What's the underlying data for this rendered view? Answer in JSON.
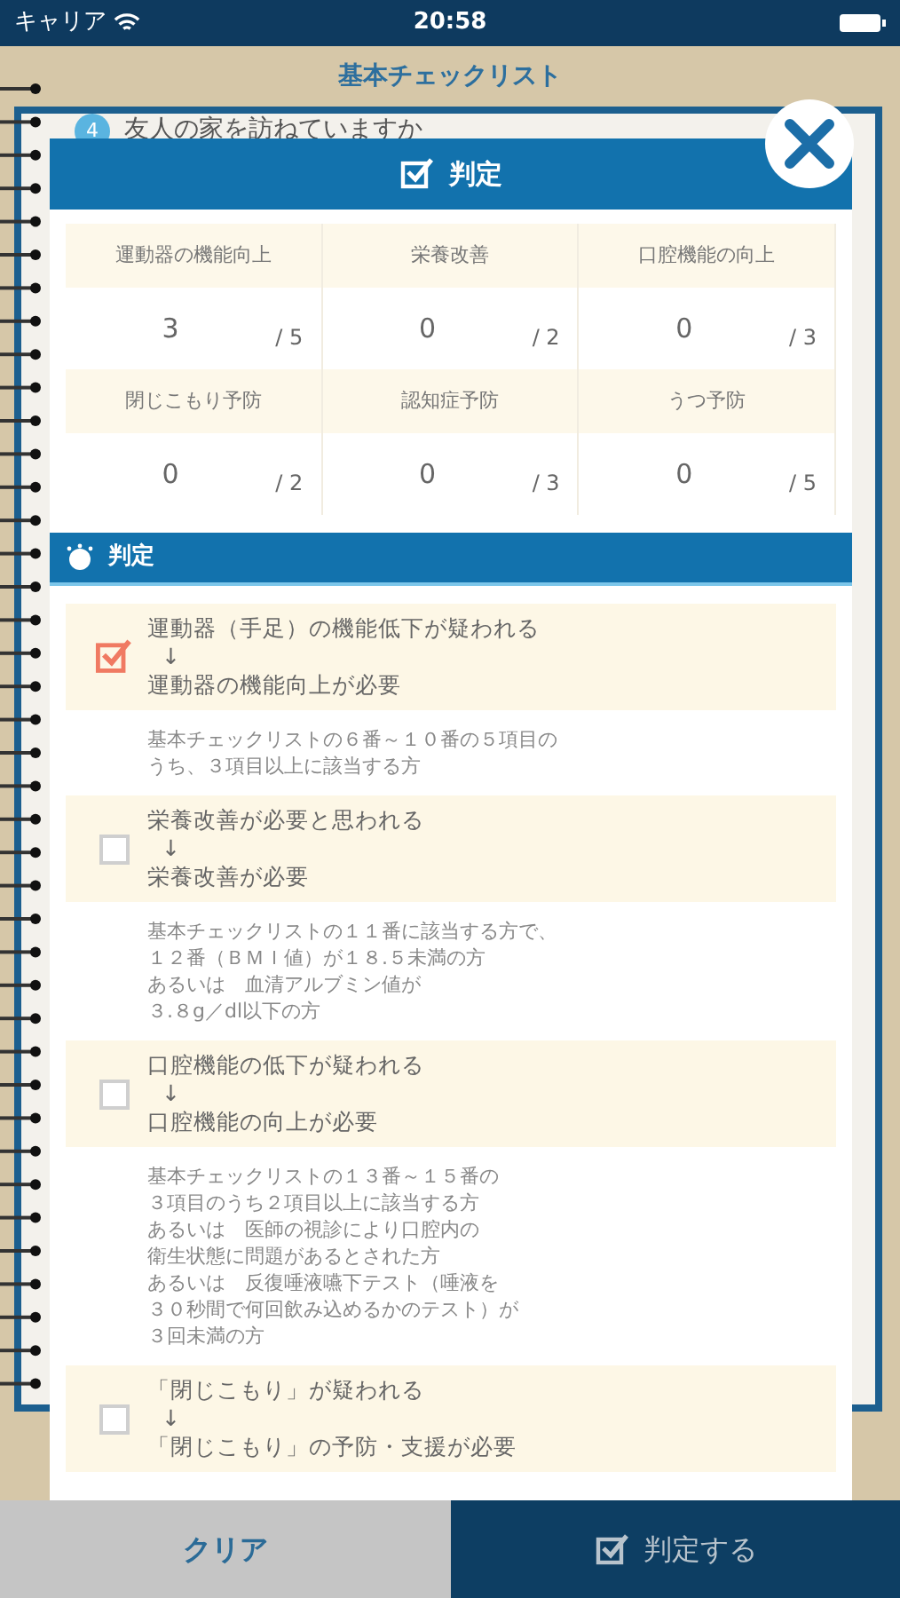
{
  "status_bar": {
    "carrier": "キャリア",
    "time": "20:58"
  },
  "title": "基本チェックリスト",
  "background_question": {
    "number": "4",
    "text": "友人の家を訪ねていますか"
  },
  "dialog": {
    "title": "判定",
    "scores": [
      {
        "label": "運動器の機能向上",
        "value": "3",
        "max": "/ 5"
      },
      {
        "label": "栄養改善",
        "value": "0",
        "max": "/ 2"
      },
      {
        "label": "口腔機能の向上",
        "value": "0",
        "max": "/ 3"
      },
      {
        "label": "閉じこもり予防",
        "value": "0",
        "max": "/ 2"
      },
      {
        "label": "認知症予防",
        "value": "0",
        "max": "/ 3"
      },
      {
        "label": "うつ予防",
        "value": "0",
        "max": "/ 5"
      }
    ],
    "section_title": "判定",
    "results": [
      {
        "checked": true,
        "finding": "運動器（手足）の機能低下が疑われる",
        "arrow": "↓",
        "need": "運動器の機能向上が必要",
        "criteria": [
          "基本チェックリストの６番～１０番の５項目の",
          "うち、３項目以上に該当する方"
        ]
      },
      {
        "checked": false,
        "finding": "栄養改善が必要と思われる",
        "arrow": "↓",
        "need": "栄養改善が必要",
        "criteria": [
          "基本チェックリストの１１番に該当する方で、",
          "１２番（ＢＭＩ値）が１８.５未満の方",
          "あるいは　血清アルブミン値が",
          "３.８g／dl以下の方"
        ]
      },
      {
        "checked": false,
        "finding": "口腔機能の低下が疑われる",
        "arrow": "↓",
        "need": "口腔機能の向上が必要",
        "criteria": [
          "基本チェックリストの１３番～１５番の",
          "３項目のうち２項目以上に該当する方",
          "あるいは　医師の視診により口腔内の",
          "衛生状態に問題があるとされた方",
          "あるいは　反復唾液嚥下テスト（唾液を",
          "３０秒間で何回飲み込めるかのテスト）が",
          "３回未満の方"
        ]
      },
      {
        "checked": false,
        "finding": "「閉じこもり」が疑われる",
        "arrow": "↓",
        "need": "「閉じこもり」の予防・支援が必要"
      }
    ]
  },
  "buttons": {
    "clear": "クリア",
    "judge": "判定する"
  }
}
